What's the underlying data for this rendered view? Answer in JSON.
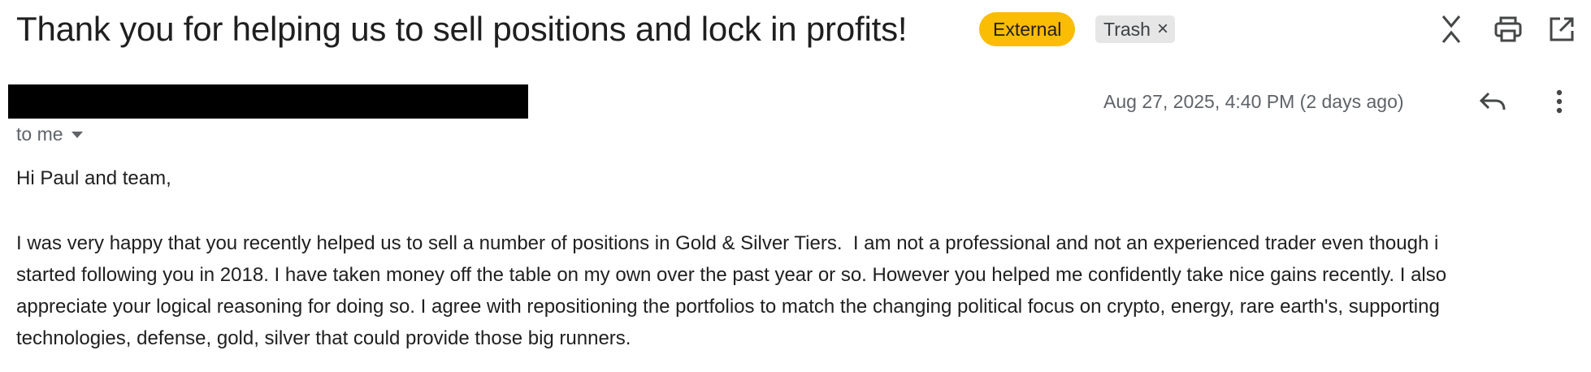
{
  "email": {
    "subject": "Thank you for helping us to sell positions and lock in profits!",
    "labels": {
      "external": "External",
      "trash": "Trash",
      "trash_remove_glyph": "×"
    },
    "header_actions": [
      {
        "name": "collapse-all-icon"
      },
      {
        "name": "print-icon"
      },
      {
        "name": "open-in-new-window-icon"
      }
    ],
    "sender": {
      "redacted": true,
      "to_line": "to me"
    },
    "date": "Aug 27, 2025, 4:40 PM (2 days ago)",
    "message_actions": [
      {
        "name": "reply-icon"
      },
      {
        "name": "more-options-icon"
      }
    ],
    "body": {
      "greeting": "Hi Paul and team,",
      "lines": [
        "I was very happy that you recently helped us to sell a number of positions in Gold & Silver Tiers.  I am not a professional and not an experienced trader even though i",
        "started following you in 2018. I have taken money off the table on my own over the past year or so. However you helped me confidently take nice gains recently. I also",
        "appreciate your logical reasoning for doing so. I agree with repositioning the portfolios to match the changing political focus on crypto, energy, rare earth's, supporting",
        "technologies, defense, gold, silver that could provide those big runners."
      ]
    }
  },
  "colors": {
    "external_chip": "#fbbc04",
    "trash_chip": "#e6e6e6",
    "secondary_text": "#5f6368",
    "primary_text": "#1f1f1f"
  }
}
